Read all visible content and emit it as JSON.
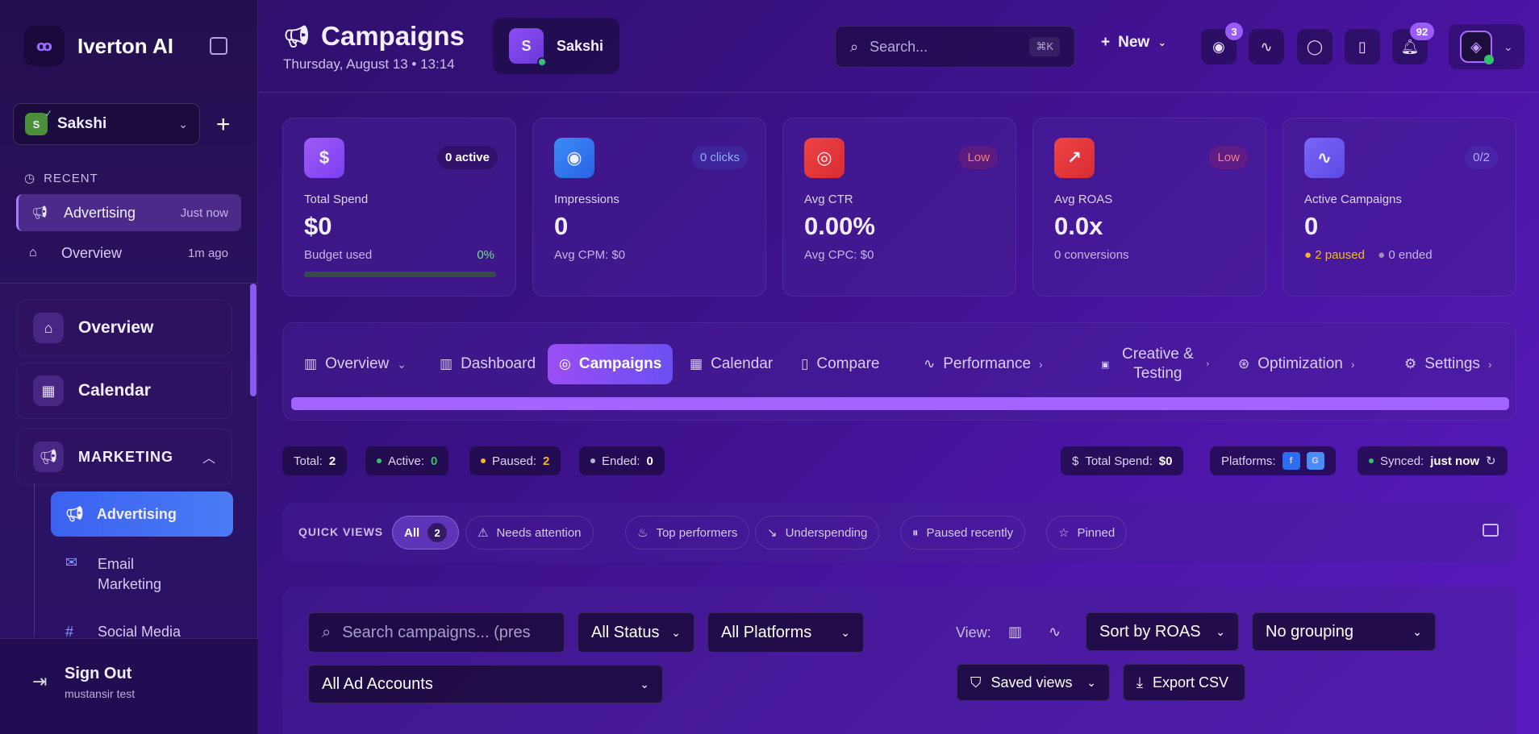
{
  "sidebar": {
    "brand_name": "Iverton AI",
    "workspace": {
      "initial": "S",
      "name": "Sakshi"
    },
    "recent_heading": "RECENT",
    "recent": [
      {
        "label": "Advertising",
        "time": "Just now"
      },
      {
        "label": "Overview",
        "time": "1m ago"
      }
    ],
    "nav": [
      {
        "label": "Overview"
      },
      {
        "label": "Calendar"
      },
      {
        "label": "MARKETING"
      }
    ],
    "sub_items": [
      {
        "label": "Advertising"
      },
      {
        "label": "Email Marketing"
      },
      {
        "label": "Social Media"
      }
    ],
    "sign_out": {
      "label": "Sign Out",
      "user": "mustansir test"
    }
  },
  "header": {
    "title": "Campaigns",
    "date": "Thursday, August 13 • 13:14",
    "user_initial": "S",
    "user_name": "Sakshi",
    "search_placeholder": "Search...",
    "search_shortcut": "⌘K",
    "new_label": "New",
    "badges": {
      "ai": "3",
      "notifications": "92"
    }
  },
  "stats": [
    {
      "label": "Total Spend",
      "value": "$0",
      "pill": "0 active",
      "sub": "Budget used",
      "pct": "0%",
      "color": "#9a4ef5"
    },
    {
      "label": "Impressions",
      "value": "0",
      "pill": "0 clicks",
      "sub": "Avg CPM: $0",
      "color": "#2e7df2"
    },
    {
      "label": "Avg CTR",
      "value": "0.00%",
      "pill": "Low",
      "sub": "Avg CPC: $0",
      "color": "#e0373d"
    },
    {
      "label": "Avg ROAS",
      "value": "0.0x",
      "pill": "Low",
      "sub": "0 conversions",
      "color": "#e0373d"
    },
    {
      "label": "Active Campaigns",
      "value": "0",
      "pill": "0/2",
      "sub_paused": "2 paused",
      "sub_ended": "0 ended",
      "color": "#6d53f0"
    }
  ],
  "tabs": [
    {
      "label": "Overview"
    },
    {
      "label": "Dashboard"
    },
    {
      "label": "Campaigns"
    },
    {
      "label": "Calendar"
    },
    {
      "label": "Compare"
    },
    {
      "label": "Performance"
    },
    {
      "label": "Creative & Testing"
    },
    {
      "label": "Optimization"
    },
    {
      "label": "Settings"
    }
  ],
  "summary": {
    "total_label": "Total:",
    "total": "2",
    "active_label": "Active:",
    "active": "0",
    "paused_label": "Paused:",
    "paused": "2",
    "ended_label": "Ended:",
    "ended": "0",
    "spend_label": "Total Spend:",
    "spend": "$0",
    "platforms_label": "Platforms:",
    "platform_f": "f",
    "platform_g": "G",
    "synced_label": "Synced:",
    "synced": "just now"
  },
  "quick_views": {
    "heading": "QUICK VIEWS",
    "items": [
      {
        "label": "All",
        "count": "2"
      },
      {
        "label": "Needs attention"
      },
      {
        "label": "Top performers"
      },
      {
        "label": "Underspending"
      },
      {
        "label": "Paused recently"
      },
      {
        "label": "Pinned"
      }
    ]
  },
  "filters": {
    "search_placeholder": "Search campaigns... (pres",
    "status": "All Status",
    "platforms": "All Platforms",
    "accounts": "All Ad Accounts",
    "view_label": "View:",
    "sort": "Sort by ROAS",
    "grouping": "No grouping",
    "saved_views": "Saved views",
    "export": "Export CSV"
  }
}
